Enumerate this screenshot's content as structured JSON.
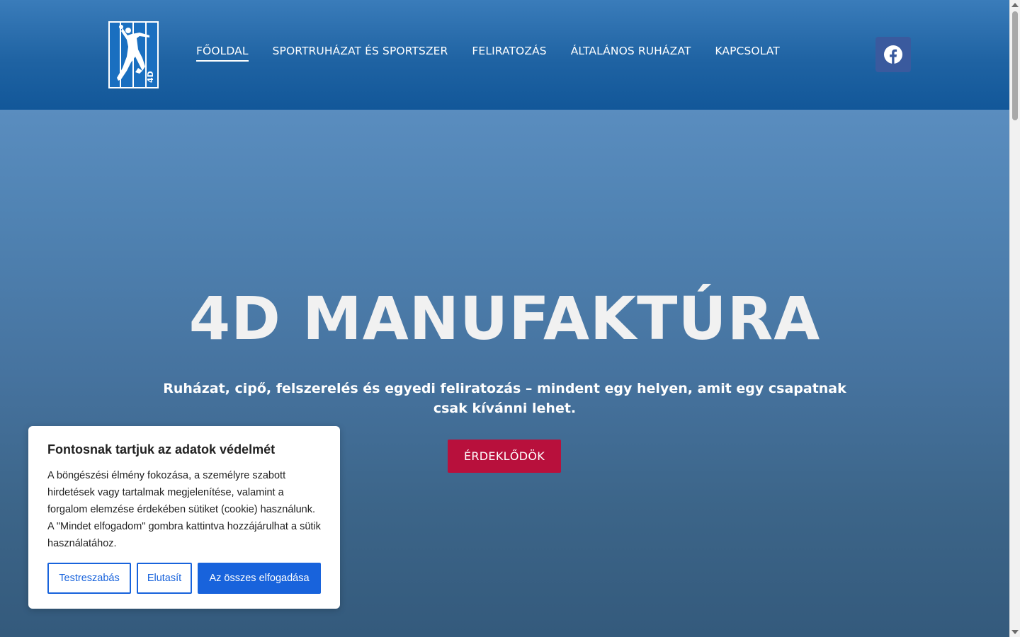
{
  "header": {
    "logo_text": "4D",
    "nav": [
      {
        "label": "FŐOLDAL",
        "active": true
      },
      {
        "label": "SPORTRUHÁZAT ÉS SPORTSZER",
        "active": false
      },
      {
        "label": "FELIRATOZÁS",
        "active": false
      },
      {
        "label": "ÁLTALÁNOS RUHÁZAT",
        "active": false
      },
      {
        "label": "KAPCSOLAT",
        "active": false
      }
    ],
    "social_icon": "facebook-icon"
  },
  "hero": {
    "title": "4D MANUFAKTÚRA",
    "subtitle": "Ruházat, cipő, felszerelés és egyedi feliratozás – mindent egy helyen, amit egy csapatnak csak kívánni lehet.",
    "cta_label": "ÉRDEKLŐDÖK"
  },
  "cookie_banner": {
    "title": "Fontosnak tartjuk az adatok védelmét",
    "text": "A böngészési élmény fokozása, a személyre szabott hirdetések vagy tartalmak megjelenítése, valamint a forgalom elemzése érdekében sütiket (cookie) használunk. A \"Mindet elfogadom\" gombra kattintva hozzájárulhat a sütik használatához.",
    "customize_label": "Testreszabás",
    "reject_label": "Elutasít",
    "accept_label": "Az összes elfogadása"
  },
  "colors": {
    "header_blue": "#1f63a3",
    "cta_red": "#b8103c",
    "cookie_blue": "#1863dc",
    "facebook_bg": "#3a5a9e"
  }
}
